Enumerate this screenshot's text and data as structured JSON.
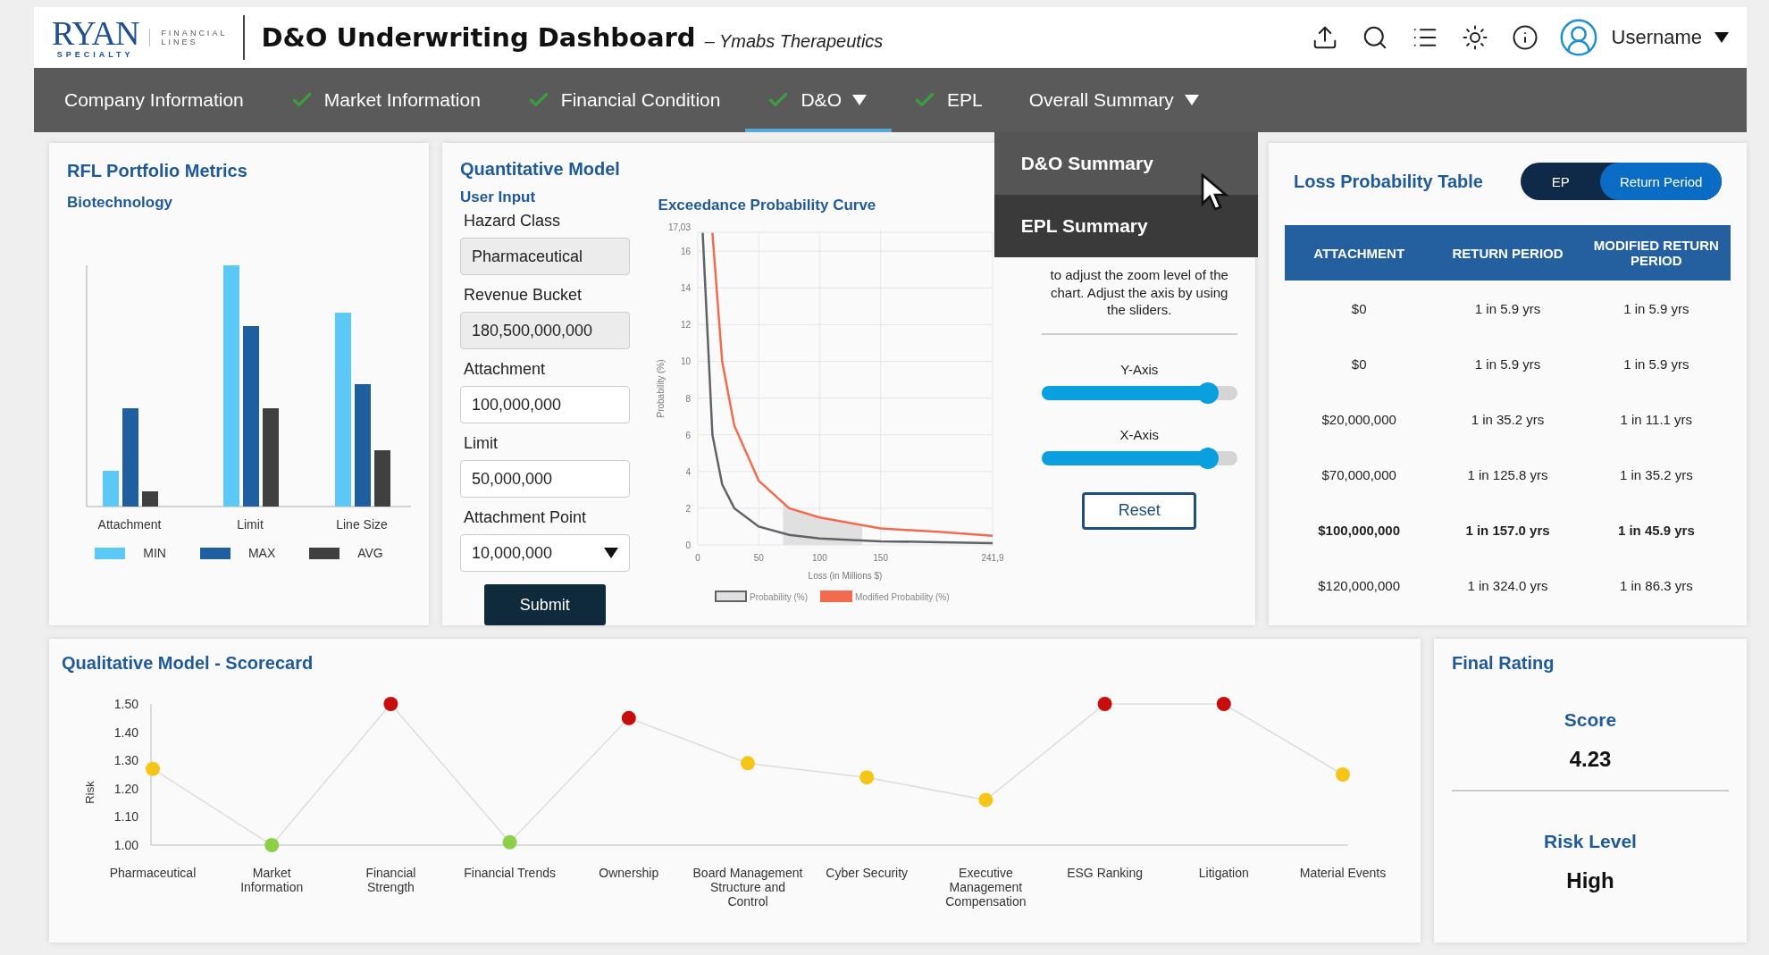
{
  "header": {
    "logo": {
      "name": "RYAN",
      "tagline": "SPECIALTY",
      "division_lines": [
        "FINANCIAL",
        "LINES"
      ]
    },
    "title": "D&O Underwriting Dashboard",
    "subtitle": "– Ymabs Therapeutics",
    "username": "Username"
  },
  "nav": {
    "tabs": [
      {
        "label": "Company Information",
        "checked": false,
        "selected": false,
        "has_menu": false
      },
      {
        "label": "Market Information",
        "checked": true,
        "selected": false,
        "has_menu": false
      },
      {
        "label": "Financial Condition",
        "checked": true,
        "selected": false,
        "has_menu": false
      },
      {
        "label": "D&O",
        "checked": true,
        "selected": true,
        "has_menu": true
      },
      {
        "label": "EPL",
        "checked": true,
        "selected": false,
        "has_menu": false
      },
      {
        "label": "Overall Summary",
        "checked": false,
        "selected": false,
        "has_menu": true,
        "expanded": true,
        "menu": [
          {
            "label": "D&O Summary",
            "selected": true
          },
          {
            "label": "EPL Summary",
            "selected": false
          }
        ]
      }
    ]
  },
  "rfl": {
    "title": "RFL Portfolio Metrics",
    "subtitle": "Biotechnology",
    "categories": [
      "Attachment",
      "Limit",
      "Line Size"
    ],
    "legend": [
      {
        "label": "MIN",
        "color": "#5bc8f5"
      },
      {
        "label": "MAX",
        "color": "#1f5fa0"
      },
      {
        "label": "AVG",
        "color": "#404040"
      }
    ]
  },
  "quant": {
    "title": "Quantitative Model",
    "user_input": {
      "title": "User Input",
      "fields": [
        {
          "label": "Hazard Class",
          "value": "Pharmaceutical",
          "kind": "text",
          "disabled": true
        },
        {
          "label": "Revenue Bucket",
          "value": "180,500,000,000",
          "kind": "text",
          "disabled": true
        },
        {
          "label": "Attachment",
          "value": "100,000,000",
          "kind": "text",
          "disabled": false
        },
        {
          "label": "Limit",
          "value": "50,000,000",
          "kind": "text",
          "disabled": false
        },
        {
          "label": "Attachment Point",
          "value": "10,000,000",
          "kind": "select",
          "disabled": false
        }
      ],
      "submit": "Submit"
    },
    "ep_curve": {
      "title": "Exceedance Probability Curve",
      "chart_data": {
        "type": "line",
        "xlabel": "Loss (in Millions $)",
        "ylabel": "Probability (%)",
        "x": [
          4,
          12,
          20,
          30,
          50,
          75,
          100,
          150,
          200,
          241.9
        ],
        "series": [
          {
            "name": "Probability (%)",
            "color": "#5f6368",
            "values": [
              17,
              6,
              3.3,
              2,
              1,
              0.55,
              0.35,
              0.2,
              0.15,
              0.1
            ]
          },
          {
            "name": "Modified Probability (%)",
            "color": "#f26b4f",
            "values": [
              null,
              17,
              10,
              6.5,
              3.5,
              2,
              1.5,
              0.9,
              0.7,
              0.5
            ]
          }
        ],
        "xlim": [
          0,
          241.9
        ],
        "ylim": [
          0,
          17.03
        ],
        "xticks": [
          0,
          50,
          100,
          150,
          {
            "value": 241.9,
            "label": "241,9"
          }
        ],
        "yticks": [
          0,
          2,
          4,
          6,
          8,
          10,
          12,
          14,
          16,
          {
            "value": 17.03,
            "label": "17,03"
          }
        ],
        "grid": true,
        "legend": "bottom"
      }
    },
    "controls": {
      "help": "to adjust the zoom level of the chart. Adjust the axis by using the sliders.",
      "sliders": [
        {
          "label": "Y-Axis",
          "level": 0.85
        },
        {
          "label": "X-Axis",
          "level": 0.85
        }
      ],
      "reset": "Reset"
    }
  },
  "loss_table": {
    "title": "Loss Probability Table",
    "toggle": [
      {
        "label": "EP",
        "selected": false
      },
      {
        "label": "Return Period",
        "selected": true
      }
    ],
    "columns": [
      "ATTACHMENT",
      "RETURN PERIOD",
      "MODIFIED RETURN PERIOD"
    ],
    "rows": [
      {
        "cells": [
          "$0",
          "1 in 5.9 yrs",
          "1 in 5.9 yrs"
        ],
        "emphasized": false
      },
      {
        "cells": [
          "$0",
          "1 in 5.9 yrs",
          "1 in 5.9 yrs"
        ],
        "emphasized": false
      },
      {
        "cells": [
          "$20,000,000",
          "1 in 35.2 yrs",
          "1 in 11.1 yrs"
        ],
        "emphasized": false
      },
      {
        "cells": [
          "$70,000,000",
          "1 in 125.8 yrs",
          "1 in 35.2 yrs"
        ],
        "emphasized": false
      },
      {
        "cells": [
          "$100,000,000",
          "1 in 157.0 yrs",
          "1 in 45.9 yrs"
        ],
        "emphasized": true
      },
      {
        "cells": [
          "$120,000,000",
          "1 in 324.0 yrs",
          "1 in 86.3 yrs"
        ],
        "emphasized": false
      }
    ]
  },
  "scorecard": {
    "title": "Qualitative Model - Scorecard",
    "chart_data": {
      "type": "line",
      "ylabel": "Risk",
      "categories": [
        "Pharmaceutical",
        "Market Information",
        "Financial Strength",
        "Financial Trends",
        "Ownership",
        "Board Management Structure and Control",
        "Cyber Security",
        "Executive Management Compensation",
        "ESG Ranking",
        "Litigation",
        "Material Events"
      ],
      "series": [
        {
          "color": "#dddddd",
          "marker": "circle",
          "values": [
            1.27,
            1.0,
            1.5,
            1.01,
            1.45,
            1.29,
            1.24,
            1.16,
            1.5,
            1.5,
            1.25
          ]
        }
      ],
      "ylim": [
        1,
        1.5
      ],
      "yticks": [
        {
          "value": 1,
          "label": "1.00"
        },
        {
          "value": 1.1,
          "label": "1.10"
        },
        {
          "value": 1.2,
          "label": "1.20"
        },
        {
          "value": 1.3,
          "label": "1.30"
        },
        {
          "value": 1.4,
          "label": "1.40"
        },
        {
          "value": 1.5,
          "label": "1.50"
        }
      ]
    }
  },
  "final_rating": {
    "title": "Final Rating",
    "score_label": "Score",
    "score": "4.23",
    "risk_label": "Risk Level",
    "risk": "High"
  }
}
